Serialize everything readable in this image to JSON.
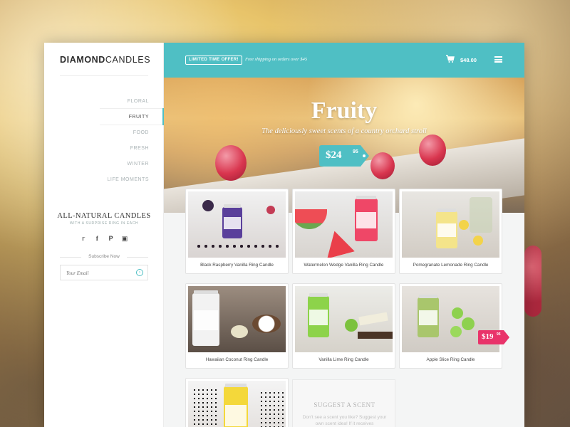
{
  "logo": {
    "bold": "DIAMOND",
    "light": "CANDLES"
  },
  "nav": {
    "items": [
      {
        "label": "FLORAL"
      },
      {
        "label": "FRUITY"
      },
      {
        "label": "FOOD"
      },
      {
        "label": "FRESH"
      },
      {
        "label": "WINTER"
      },
      {
        "label": "LIFE MOMENTS"
      }
    ],
    "active": "FRUITY"
  },
  "sidebar": {
    "heading": "ALL-NATURAL CANDLES",
    "subheading": "WITH A SURPRISE RING IN EACH",
    "social_icons": [
      "twitter-icon",
      "facebook-icon",
      "pinterest-icon",
      "instagram-icon"
    ],
    "subscribe_label": "Subscribe Now",
    "email_placeholder": "Your Email"
  },
  "topbar": {
    "offer_badge": "LIMITED TIME OFFER!",
    "offer_text": "Free shipping on orders over $45",
    "cart_total": "$48.00"
  },
  "hero": {
    "title": "Fruity",
    "subtitle": "The deliciously sweet scents of a country orchard stroll",
    "price_dollars": "$24",
    "price_cents": "95"
  },
  "products": [
    {
      "name": "Black Raspberry Vanilla Ring Candle"
    },
    {
      "name": "Watermelon Wedge Vanilla Ring Candle"
    },
    {
      "name": "Pomegranate Lemonade Ring Candle"
    },
    {
      "name": "Hawaiian Coconut Ring Candle"
    },
    {
      "name": "Vanilla Lime Ring Candle"
    },
    {
      "name": "Apple Slice Ring Candle"
    }
  ],
  "sale_tag": {
    "dollars": "$19",
    "cents": "95"
  },
  "suggest": {
    "title": "SUGGEST A SCENT",
    "description": "Don't see a scent you like? Suggest your own scent idea! If it receives"
  },
  "colors": {
    "accent": "#4fbfc4",
    "sale": "#e9336a"
  }
}
